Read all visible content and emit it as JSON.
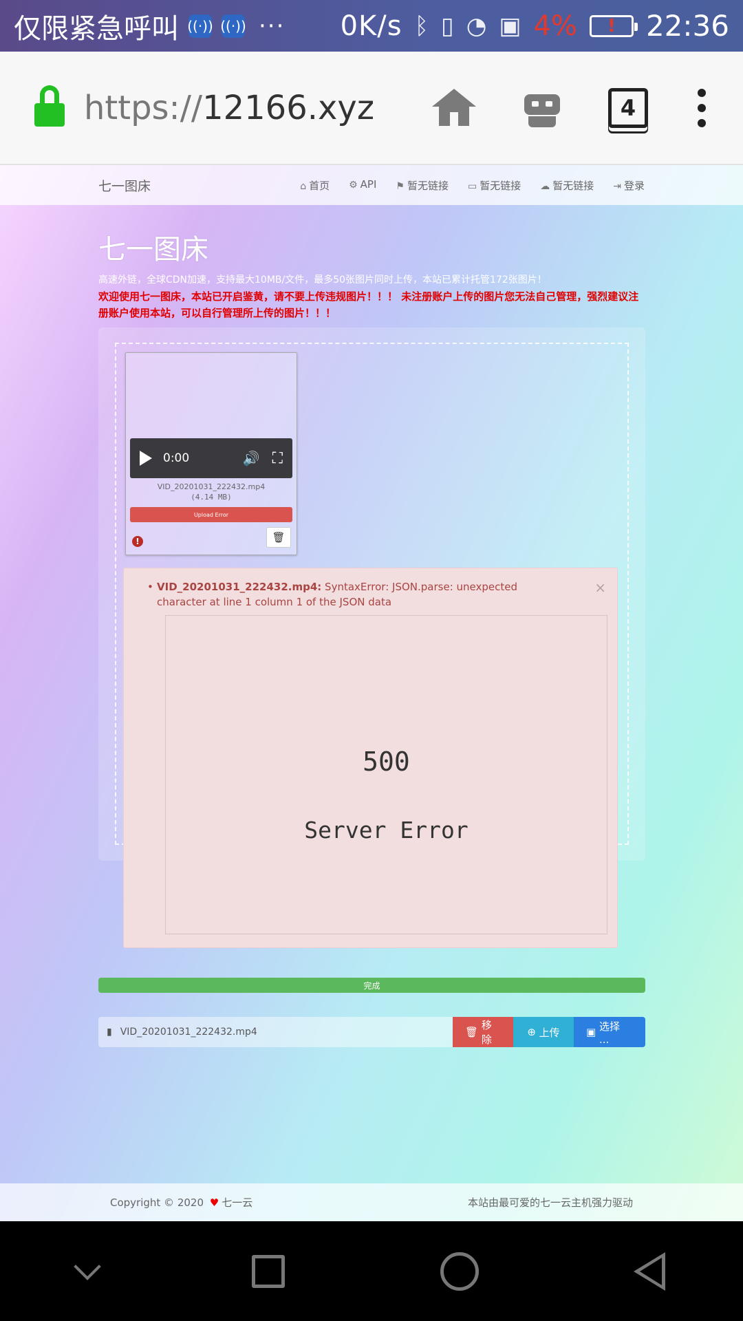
{
  "status_bar": {
    "emergency_text": "仅限紧急呼叫",
    "more": "···",
    "speed": "0K/s",
    "battery_pct": "4%",
    "battery_alert": "!",
    "time": "22:36"
  },
  "browser": {
    "url_scheme": "https://",
    "url_host": "12166.xyz",
    "tab_count": "4"
  },
  "site_nav": {
    "brand": "七一图床",
    "links": [
      {
        "icon": "⌂",
        "label": "首页"
      },
      {
        "icon": "⚙",
        "label": "API"
      },
      {
        "icon": "⚑",
        "label": "暂无链接"
      },
      {
        "icon": "▭",
        "label": "暂无链接"
      },
      {
        "icon": "☁",
        "label": "暂无链接"
      },
      {
        "icon": "⇥",
        "label": "登录"
      }
    ]
  },
  "hero": {
    "title": "七一图床",
    "subtitle": "高速外链，全球CDN加速，支持最大10MB/文件，最多50张图片同时上传，本站已累计托管172张图片！",
    "warning": "欢迎使用七一图床，本站已开启鉴黄，请不要上传违规图片！！！ 未注册账户上传的图片您无法自己管理，强烈建议注册账户使用本站，可以自行管理所上传的图片！！！"
  },
  "thumbnail": {
    "video_time": "0:00",
    "file_name": "VID_20201031_222432.mp4",
    "file_size": "(4.14 MB)",
    "status_label": "Upload Error",
    "error_icon": "!"
  },
  "alert": {
    "file": "VID_20201031_222432.mp4:",
    "message": "SyntaxError: JSON.parse: unexpected character at line 1 column 1 of the JSON data",
    "close": "×",
    "error_code": "500",
    "error_text": "Server Error"
  },
  "progress": {
    "label": "完成",
    "percent": 100
  },
  "file_row": {
    "file_name": "VID_20201031_222432.mp4",
    "remove_label": "移除",
    "upload_label": "上传",
    "pick_label": "选择 ..."
  },
  "footer": {
    "copyright_prefix": "Copyright © 2020",
    "copyright_owner": "七一云",
    "powered_by": "本站由最可爱的七一云主机强力驱动"
  },
  "colors": {
    "danger": "#d9534f",
    "info": "#31b0d5",
    "primary": "#2a7fe0",
    "success": "#5cb85c",
    "lock_green": "#22c022"
  }
}
